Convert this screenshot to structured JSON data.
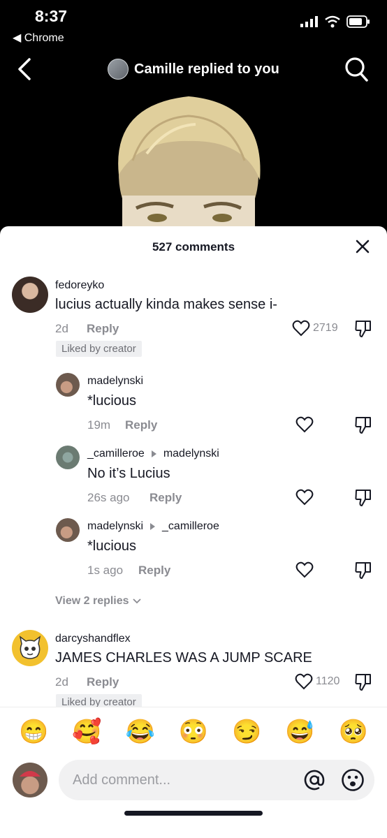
{
  "status_bar": {
    "time": "8:37",
    "back_app": "◀ Chrome"
  },
  "nav": {
    "title": "Camille replied to you"
  },
  "sheet": {
    "title": "527 comments"
  },
  "comments": [
    {
      "username": "fedoreyko",
      "text": "lucius actually kinda makes sense i-",
      "time": "2d",
      "reply_label": "Reply",
      "likes": "2719",
      "badge": "Liked by creator"
    },
    {
      "username": "madelynski",
      "text": "*lucious",
      "time": "19m",
      "reply_label": "Reply"
    },
    {
      "username": "_camilleroe",
      "reply_to": "madelynski",
      "text": "No it’s Lucius",
      "time": "26s ago",
      "reply_label": "Reply"
    },
    {
      "username": "madelynski",
      "reply_to": "_camilleroe",
      "text": "*lucious",
      "time": "1s ago",
      "reply_label": "Reply"
    },
    {
      "username": "darcyshandflex",
      "text": "JAMES CHARLES WAS A JUMP SCARE",
      "time": "2d",
      "reply_label": "Reply",
      "likes": "1120",
      "badge": "Liked by creator"
    }
  ],
  "view_replies": "View 2 replies",
  "emoji_bar": [
    "😁",
    "🥰",
    "😂",
    "😳",
    "😏",
    "😅",
    "🥺"
  ],
  "input": {
    "placeholder": "Add comment..."
  },
  "colors": {
    "accent_text": "#161823",
    "muted_text": "#8a8b91",
    "badge_bg": "#eeeff1"
  }
}
